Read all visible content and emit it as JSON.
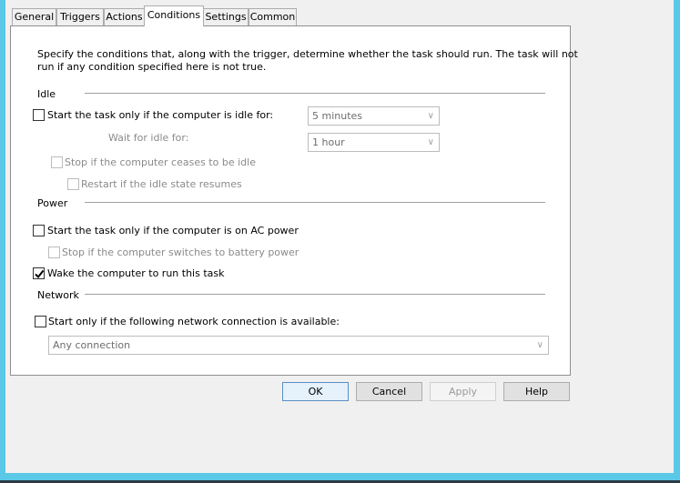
{
  "tabs": [
    {
      "label": "General"
    },
    {
      "label": "Triggers"
    },
    {
      "label": "Actions"
    },
    {
      "label": "Conditions",
      "selected": true
    },
    {
      "label": "Settings"
    },
    {
      "label": "Common"
    }
  ],
  "description_line1": "Specify the conditions that, along with the trigger, determine whether the task should run. The task will not",
  "description_line2": "run if any condition specified here is not true.",
  "idle": {
    "heading": "Idle",
    "start_if_idle": {
      "label": "Start the task only if the computer is idle for:",
      "checked": false
    },
    "idle_duration": "5 minutes",
    "wait_label": "Wait for idle for:",
    "wait_duration": "1 hour",
    "stop_if_ceases": {
      "label": "Stop if the computer ceases to be idle",
      "checked": false
    },
    "restart_if_resumes": {
      "label": "Restart if the idle state resumes",
      "checked": false
    }
  },
  "power": {
    "heading": "Power",
    "ac_power": {
      "label": "Start the task only if the computer is on AC power",
      "checked": false
    },
    "battery_stop": {
      "label": "Stop if the computer switches to battery power",
      "checked": false
    },
    "wake": {
      "label": "Wake the computer to run this task",
      "checked": true
    }
  },
  "network": {
    "heading": "Network",
    "start_if_network": {
      "label": "Start only if the following network connection is available:",
      "checked": false
    },
    "connection": "Any connection"
  },
  "buttons": {
    "ok": "OK",
    "cancel": "Cancel",
    "apply": "Apply",
    "help": "Help"
  },
  "colors": {
    "frame": "#5bc8e8",
    "background": "#f0f0f0"
  }
}
